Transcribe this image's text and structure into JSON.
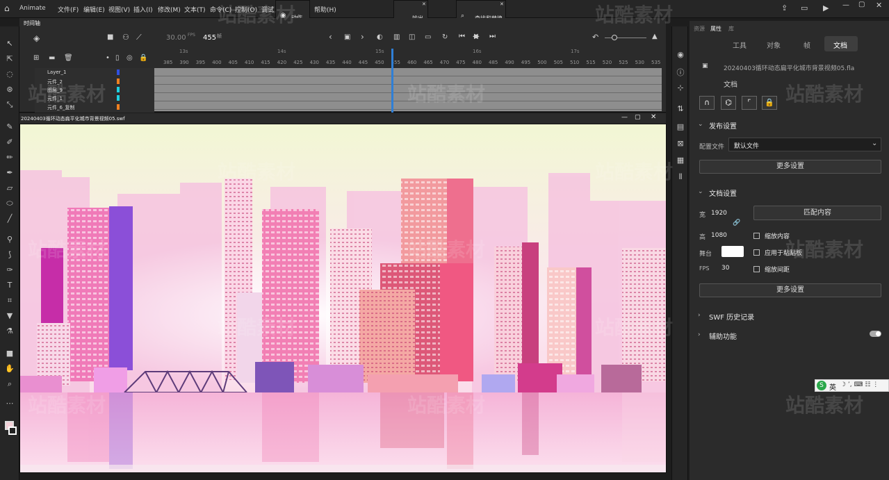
{
  "app": {
    "name": "Animate"
  },
  "menu": [
    "文件(F)",
    "编辑(E)",
    "视图(V)",
    "插入(I)",
    "修改(M)",
    "文本(T)",
    "命令(C)",
    "控制(O)",
    "调试",
    "帮助(H)"
  ],
  "panels": {
    "actions": "动作",
    "output": "输出",
    "find_replace": "查找和替换"
  },
  "timeline": {
    "tab": "时间轴",
    "fps": "30.00",
    "fps_unit": "FPS",
    "frame": "455",
    "frame_unit": "帧",
    "layers": [
      "Layer_1",
      "元件_2",
      "图层_9",
      "元件_1",
      "元件_6_复制"
    ],
    "seconds": [
      "13s",
      "14s",
      "15s",
      "16s",
      "17s"
    ],
    "ruler": [
      "385",
      "390",
      "395",
      "400",
      "405",
      "410",
      "415",
      "420",
      "425",
      "430",
      "435",
      "440",
      "445",
      "450",
      "455",
      "460",
      "465",
      "470",
      "475",
      "480",
      "485",
      "490",
      "495",
      "500",
      "505",
      "510",
      "515",
      "520",
      "525",
      "530",
      "535"
    ]
  },
  "document": {
    "tab": "20240403循环动态扁平化城市背景视频05.swf"
  },
  "properties": {
    "panel_tabs": [
      "资源",
      "属性",
      "库"
    ],
    "tabs": [
      "工具",
      "对象",
      "帧",
      "文档"
    ],
    "active_tab": "文档",
    "file_name": "20240403循环动态扁平化城市背景视频05.fla",
    "doc_label": "文档",
    "publish": {
      "title": "发布设置",
      "profile_label": "配置文件",
      "profile_value": "默认文件",
      "more": "更多设置"
    },
    "doc_settings": {
      "title": "文档设置",
      "width_label": "宽",
      "width": "1920",
      "height_label": "高",
      "height": "1080",
      "match": "匹配内容",
      "stage_label": "舞台",
      "fps_label": "FPS",
      "fps": "30",
      "checks": [
        "缩放内容",
        "应用于粘贴板",
        "缩放间距"
      ],
      "more": "更多设置"
    },
    "swf_history": "SWF 历史记录",
    "accessibility": "辅助功能"
  },
  "ime": {
    "label": "英"
  },
  "watermark": "站酷素材",
  "colors": {
    "accent": "#2f7fd6",
    "stage_bg": "#ffffff"
  }
}
